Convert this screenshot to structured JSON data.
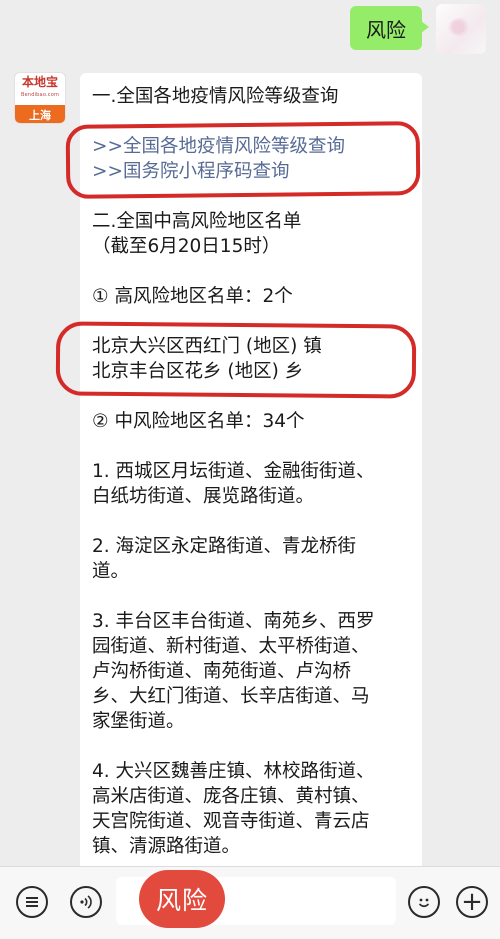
{
  "user_message": {
    "text": "风险"
  },
  "bot": {
    "logo_text": "本地宝",
    "logo_subtext": "Bendibao.com",
    "city": "上海"
  },
  "card": {
    "section1_title": "一.全国各地疫情风险等级查询",
    "link1": ">>全国各地疫情风险等级查询",
    "link2": ">>国务院小程序码查询",
    "section2_title": "二.全国中高风险地区名单",
    "section2_date": "（截至6月20日15时）",
    "high_risk_title": "① 高风险地区名单：2个",
    "high_risk_1": "北京大兴区西红门 (地区) 镇",
    "high_risk_2": "北京丰台区花乡 (地区) 乡",
    "mid_risk_title": "② 中风险地区名单：34个",
    "items": [
      [
        "1. 西城区月坛街道、金融街街道、",
        "白纸坊街道、展览路街道。"
      ],
      [
        "2. 海淀区永定路街道、青龙桥街",
        "道。"
      ],
      [
        "3. 丰台区丰台街道、南苑乡、西罗",
        "园街道、新村街道、太平桥街道、",
        "卢沟桥街道、南苑街道、卢沟桥",
        "乡、大红门街道、长辛店街道、马",
        "家堡街道。"
      ],
      [
        "4. 大兴区魏善庄镇、林校路街道、",
        "高米店街道、庞各庄镇、黄村镇、",
        "天宫院街道、观音寺街道、青云店",
        "镇、清源路街道。"
      ]
    ]
  },
  "bottom_bar": {
    "send_label": "风险",
    "plus_symbol": "+"
  },
  "colors": {
    "user_bubble": "#95ec69",
    "link": "#576b95",
    "annotation": "#d42a28",
    "send_pill": "#e34a3e"
  }
}
